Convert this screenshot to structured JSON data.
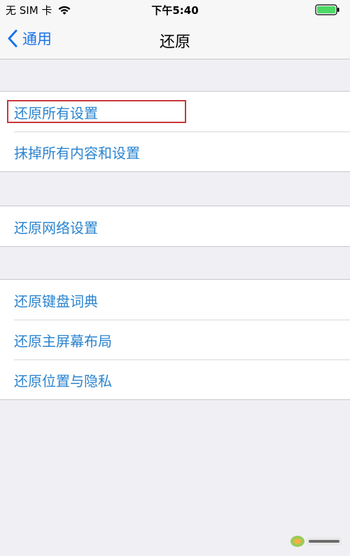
{
  "status_bar": {
    "carrier": "无 SIM 卡",
    "time": "下午5:40",
    "wifi_icon": "wifi-icon",
    "battery_icon": "battery-icon",
    "battery_color": "#4cd964"
  },
  "nav": {
    "back_label": "通用",
    "title": "还原"
  },
  "groups": [
    {
      "items": [
        "还原所有设置",
        "抹掉所有内容和设置"
      ]
    },
    {
      "items": [
        "还原网络设置"
      ]
    },
    {
      "items": [
        "还原键盘词典",
        "还原主屏幕布局",
        "还原位置与隐私"
      ]
    }
  ],
  "highlighted_item": "还原所有设置",
  "colors": {
    "accent": "#1a73e8",
    "item_text": "#2b84cf",
    "highlight_border": "#c9363a",
    "background": "#efeff4"
  }
}
